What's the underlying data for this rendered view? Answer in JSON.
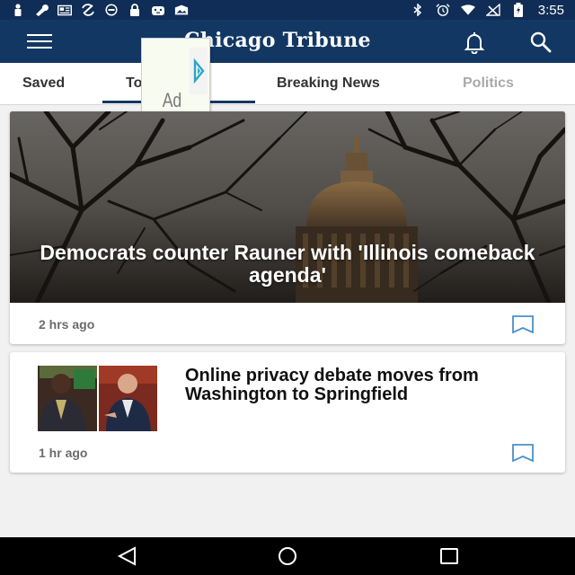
{
  "status_bar": {
    "time": "3:55",
    "left_icons": [
      "person-icon",
      "wrench-icon",
      "newspaper-icon",
      "no-sync-icon",
      "circle-info-icon",
      "lock-icon",
      "android-icon",
      "image-icon"
    ],
    "right_icons": [
      "bluetooth-icon",
      "alarm-icon",
      "wifi-icon",
      "no-signal-icon",
      "battery-charging-icon"
    ]
  },
  "app_bar": {
    "brand": "Chicago Tribune",
    "menu_icon": "hamburger-menu-icon",
    "notification_icon": "bell-icon",
    "search_icon": "search-icon"
  },
  "tabs": [
    {
      "label": "Saved",
      "active": false
    },
    {
      "label": "Top Stories",
      "active": true
    },
    {
      "label": "Breaking News",
      "active": false
    },
    {
      "label": "Politics",
      "active": false
    }
  ],
  "ad": {
    "label": "Ad",
    "badge_icon": "adchoices-icon"
  },
  "stories": [
    {
      "title": "Democrats counter Rauner with 'Illinois comeback agenda'",
      "time": "2 hrs ago",
      "bookmark_icon": "bookmark-icon"
    },
    {
      "title": "Online privacy debate moves from Washington to Springfield",
      "time": "1 hr ago",
      "bookmark_icon": "bookmark-icon"
    }
  ],
  "nav_bar": {
    "back_icon": "back-triangle-icon",
    "home_icon": "home-circle-icon",
    "recents_icon": "recents-square-icon"
  },
  "colors": {
    "status_bar": "#0f2d56",
    "app_bar": "#123763",
    "bookmark": "#4a90c9",
    "background": "#f1f1f1"
  }
}
